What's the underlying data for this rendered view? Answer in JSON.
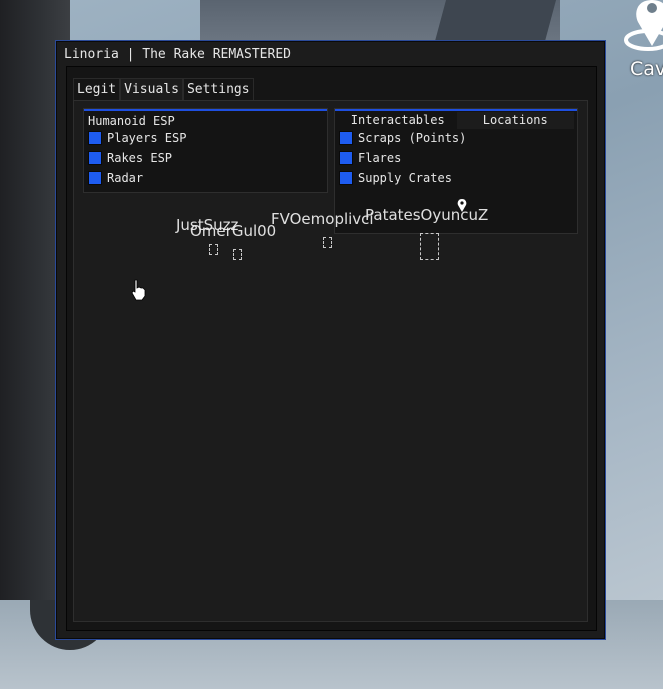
{
  "window": {
    "title": "Linoria | The Rake REMASTERED",
    "accent_color": "#1e5cf0"
  },
  "tabs": [
    {
      "label": "Legit",
      "active": false
    },
    {
      "label": "Visuals",
      "active": true
    },
    {
      "label": "Settings",
      "active": false
    }
  ],
  "humanoid_esp": {
    "title": "Humanoid ESP",
    "toggles": [
      {
        "label": "Players ESP",
        "checked": true
      },
      {
        "label": "Rakes ESP",
        "checked": true
      },
      {
        "label": "Radar",
        "checked": true
      }
    ]
  },
  "objects_group": {
    "sub_tabs": [
      {
        "label": "Interactables",
        "active": true
      },
      {
        "label": "Locations",
        "active": false
      }
    ],
    "toggles": [
      {
        "label": "Scraps (Points)",
        "checked": true
      },
      {
        "label": "Flares",
        "checked": true
      },
      {
        "label": "Supply Crates",
        "checked": true
      }
    ]
  },
  "esp_overlay": {
    "player_names": [
      "JustSuzz",
      "OmerGul00",
      "FVOemoplivci",
      "PatatesOyuncuZ"
    ]
  },
  "world": {
    "location_marker_label": "Cav"
  }
}
